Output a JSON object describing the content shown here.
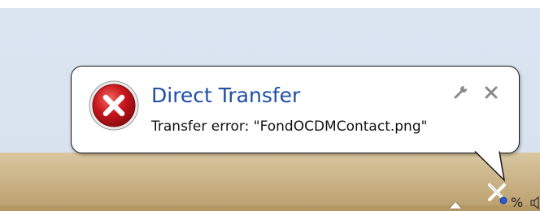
{
  "notification": {
    "title": "Direct Transfer",
    "message": "Transfer error: \"FondOCDMContact.png\"",
    "icon": "error-icon",
    "title_color": "#1f4fa6"
  },
  "tray": {
    "icons": [
      "show-hidden-icons-arrow",
      "network-error-icon",
      "battery-icon",
      "volume-icon"
    ],
    "battery_symbol": "%"
  },
  "colors": {
    "taskbar": "#c8b083",
    "desktop": "#dbe5f2",
    "error_red": "#c0181e"
  }
}
